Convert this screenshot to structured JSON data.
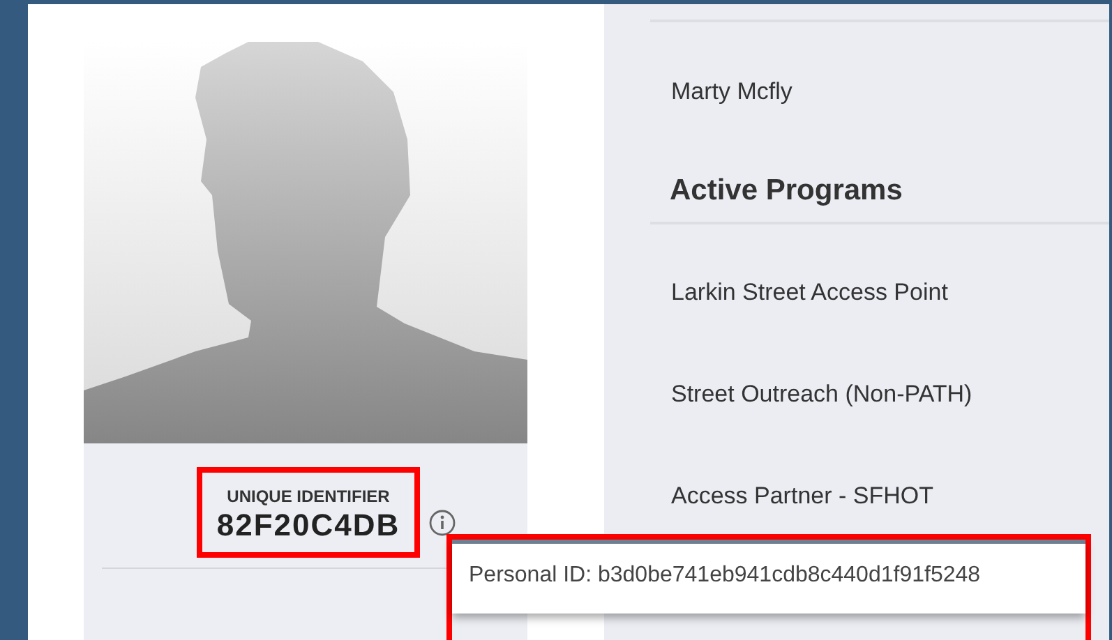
{
  "profile": {
    "identifier_label": "UNIQUE IDENTIFIER",
    "identifier": "82F20C4DB",
    "highlighted": true
  },
  "details": {
    "name": "Marty Mcfly",
    "section_title": "Active Programs",
    "programs": [
      "Larkin Street Access Point",
      "Street Outreach (Non-PATH)",
      "Access Partner - SFHOT"
    ]
  },
  "tooltip": {
    "text": "Personal ID: b3d0be741eb941cdb8c440d1f91f5248",
    "highlighted": true
  }
}
